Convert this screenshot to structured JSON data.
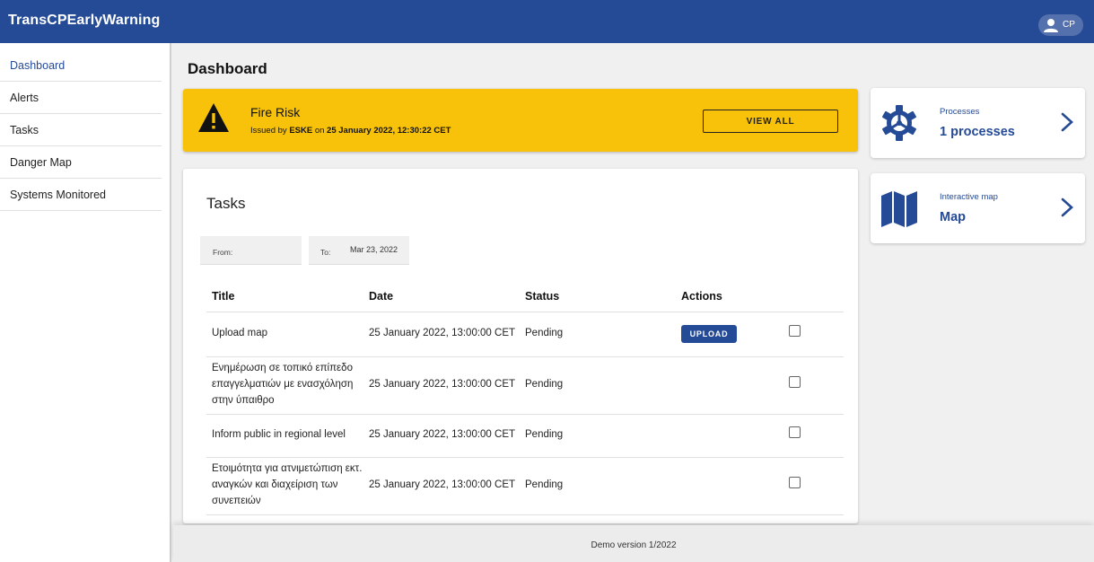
{
  "app": {
    "title": "TransCPEarlyWarning"
  },
  "user": {
    "initials": "CP"
  },
  "sidebar": {
    "items": [
      {
        "label": "Dashboard"
      },
      {
        "label": "Alerts"
      },
      {
        "label": "Tasks"
      },
      {
        "label": "Danger Map"
      },
      {
        "label": "Systems Monitored"
      }
    ]
  },
  "page": {
    "title": "Dashboard"
  },
  "alert": {
    "title": "Fire Risk",
    "issued_prefix": "Issued by",
    "issuer": "ESKE",
    "on_word": "on",
    "datetime": "25 January 2022, 12:30:22 CET",
    "view_all_label": "VIEW ALL",
    "color": "#f9c20a"
  },
  "tasks": {
    "title": "Tasks",
    "from_label": "From:",
    "from_value": "",
    "to_label": "To:",
    "to_value": "Mar 23, 2022",
    "columns": [
      "Title",
      "Date",
      "Status",
      "Actions"
    ],
    "rows": [
      {
        "title": "Upload map",
        "date": "25 January 2022, 13:00:00 CET",
        "status": "Pending",
        "action": "UPLOAD"
      },
      {
        "title": "Ενημέρωση σε τοπικό επίπεδο επαγγελματιών με ενασχόληση στην ύπαιθρο",
        "date": "25 January 2022, 13:00:00 CET",
        "status": "Pending",
        "action": ""
      },
      {
        "title": "Inform public in regional level",
        "date": "25 January 2022, 13:00:00 CET",
        "status": "Pending",
        "action": ""
      },
      {
        "title": "Ετοιμότητα για ατνιμετώπιση εκτ. αναγκών και διαχείριση των συνεπειών",
        "date": "25 January 2022, 13:00:00 CET",
        "status": "Pending",
        "action": ""
      }
    ]
  },
  "cards": {
    "processes": {
      "label": "Processes",
      "value": "1 processes",
      "icon": "gear-icon"
    },
    "map": {
      "label": "Interactive map",
      "value": "Map",
      "icon": "map-icon"
    }
  },
  "footer": {
    "text": "Demo version 1/2022"
  },
  "colors": {
    "brand": "#254a96",
    "alert": "#f9c20a"
  }
}
